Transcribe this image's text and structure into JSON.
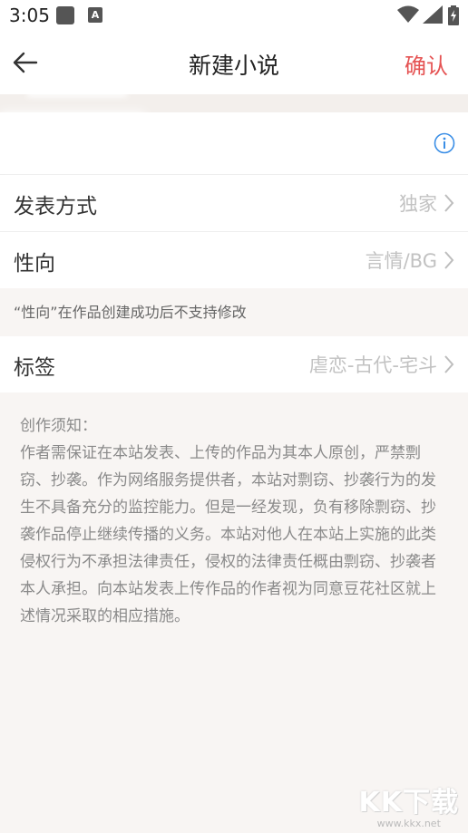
{
  "status_bar": {
    "time": "3:05",
    "icons": [
      "square-notification-icon",
      "a-notification-icon",
      "wifi-icon",
      "signal-icon",
      "battery-icon"
    ]
  },
  "header": {
    "title": "新建小说",
    "confirm_label": "确认",
    "back_icon": "arrow-left-icon",
    "accent_color": "#e55353"
  },
  "form": {
    "description_info_icon": "info-icon",
    "publish_method": {
      "label": "发表方式",
      "value": "独家"
    },
    "orientation": {
      "label": "性向",
      "value": "言情/BG"
    },
    "orientation_hint": "“性向”在作品创建成功后不支持修改",
    "tags": {
      "label": "标签",
      "value": "虐恋-古代-宅斗"
    }
  },
  "notice": {
    "title": "创作须知：",
    "body": "作者需保证在本站发表、上传的作品为其本人原创，严禁剽窃、抄袭。作为网络服务提供者，本站对剽窃、抄袭行为的发生不具备充分的监控能力。但是一经发现，负有移除剽窃、抄袭作品停止继续传播的义务。本站对他人在本站上实施的此类侵权行为不承担法律责任，侵权的法律责任概由剽窃、抄袭者本人承担。向本站发表上传作品的作者视为同意豆花社区就上述情况采取的相应措施。"
  },
  "watermark": {
    "text": "KK下载",
    "url": "www.kkx.net"
  }
}
